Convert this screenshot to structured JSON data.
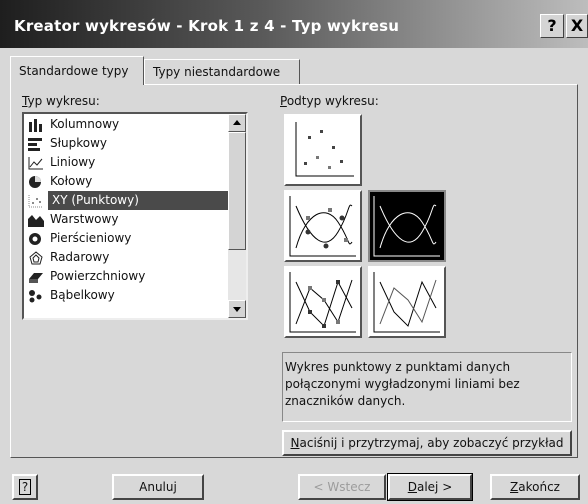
{
  "window": {
    "title": "Kreator wykresów - Krok 1 z 4 - Typ wykresu",
    "help_symbol": "?",
    "close_symbol": "X"
  },
  "tabs": [
    {
      "label": "Standardowe typy"
    },
    {
      "label": "Typy niestandardowe"
    }
  ],
  "chart_type": {
    "label": "Typ wykresu:",
    "items": [
      {
        "label": "Kolumnowy",
        "icon": "column-chart-icon"
      },
      {
        "label": "Słupkowy",
        "icon": "bar-chart-icon"
      },
      {
        "label": "Liniowy",
        "icon": "line-chart-icon"
      },
      {
        "label": "Kołowy",
        "icon": "pie-chart-icon"
      },
      {
        "label": "XY (Punktowy)",
        "icon": "scatter-chart-icon",
        "selected": true
      },
      {
        "label": "Warstwowy",
        "icon": "area-chart-icon"
      },
      {
        "label": "Pierścieniowy",
        "icon": "doughnut-chart-icon"
      },
      {
        "label": "Radarowy",
        "icon": "radar-chart-icon"
      },
      {
        "label": "Powierzchniowy",
        "icon": "surface-chart-icon"
      },
      {
        "label": "Bąbelkowy",
        "icon": "bubble-chart-icon"
      }
    ]
  },
  "subtype": {
    "label": "Podtyp wykresu:",
    "description": "Wykres punktowy z punktami danych połączonymi wygładzonymi liniami bez znaczników danych.",
    "preview_button": "Naciśnij i przytrzymaj, aby zobaczyć przykład"
  },
  "buttons": {
    "help": "?",
    "cancel": "Anuluj",
    "back": "< Wstecz",
    "next": "Dalej >",
    "finish": "Zakończ"
  },
  "colors": {
    "selection": "#4a4a4a",
    "title_start": "#1e1e1e"
  }
}
